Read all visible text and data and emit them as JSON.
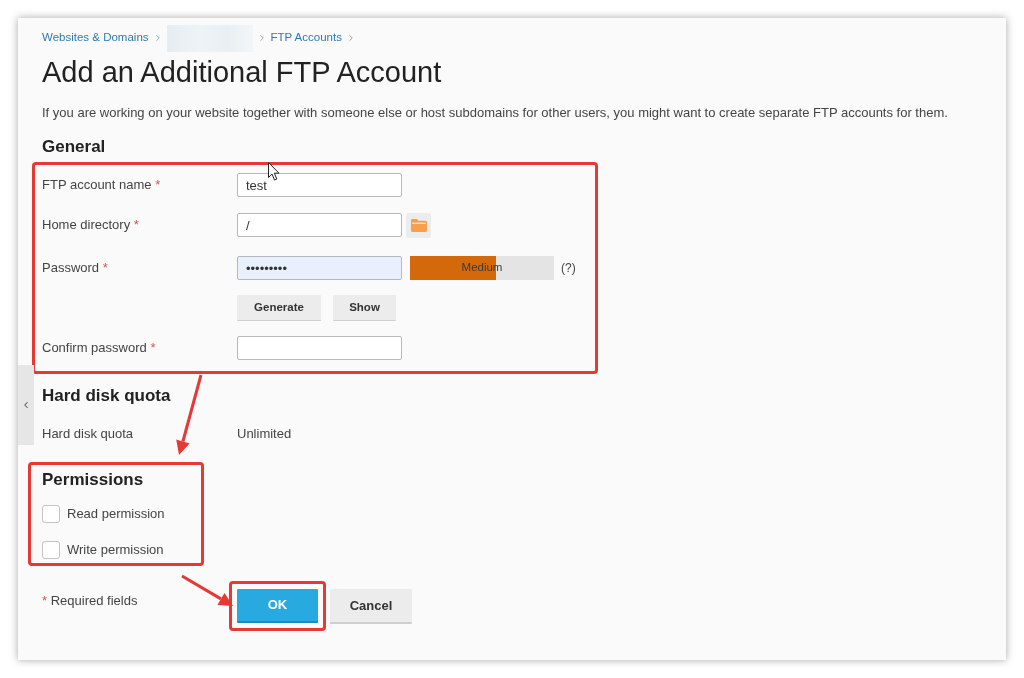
{
  "breadcrumb": [
    {
      "kind": "link",
      "label": "Websites & Domains"
    },
    {
      "kind": "redacted"
    },
    {
      "kind": "link",
      "label": "FTP Accounts"
    }
  ],
  "title": "Add an Additional FTP Account",
  "description": "If you are working on your website together with someone else or host subdomains for other users, you might want to create separate FTP accounts for them.",
  "general": {
    "heading": "General",
    "fields": [
      {
        "kind": "text",
        "label": "FTP account name",
        "required_mark": "*",
        "value": "test",
        "autofilled": false
      },
      {
        "kind": "directory",
        "label": "Home directory",
        "required_mark": "*",
        "value": "/",
        "autofilled": false
      },
      {
        "kind": "password",
        "label": "Password",
        "required_mark": "*",
        "value": "•••••••••",
        "autofilled": true,
        "strength": {
          "label": "Medium",
          "level": 0.6
        },
        "help": "(?)",
        "buttons": [
          "Generate",
          "Show"
        ]
      },
      {
        "kind": "text",
        "label": "Confirm password",
        "required_mark": "*",
        "autofilled": false
      }
    ]
  },
  "quota": {
    "heading": "Hard disk quota",
    "rows": [
      {
        "label": "Hard disk quota",
        "value": "Unlimited"
      }
    ]
  },
  "permissions": {
    "heading": "Permissions",
    "items": [
      {
        "label": "Read permission",
        "checked": false
      },
      {
        "label": "Write permission",
        "checked": false
      }
    ]
  },
  "footer": {
    "required_note": {
      "mark": "*",
      "text": "Required fields"
    },
    "buttons": [
      {
        "kind": "primary",
        "label": "OK"
      },
      {
        "kind": "secondary",
        "label": "Cancel"
      }
    ]
  }
}
